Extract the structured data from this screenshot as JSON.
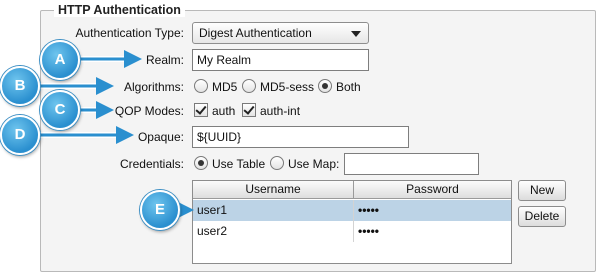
{
  "group": {
    "title": "HTTP Authentication"
  },
  "auth_type": {
    "label": "Authentication Type:",
    "value": "Digest Authentication"
  },
  "realm": {
    "label": "Realm:",
    "value": "My Realm"
  },
  "algorithms": {
    "label": "Algorithms:",
    "options": [
      {
        "label": "MD5",
        "selected": false
      },
      {
        "label": "MD5-sess",
        "selected": false
      },
      {
        "label": "Both",
        "selected": true
      }
    ]
  },
  "qop": {
    "label": "QOP Modes:",
    "options": [
      {
        "label": "auth",
        "checked": true
      },
      {
        "label": "auth-int",
        "checked": true
      }
    ]
  },
  "opaque": {
    "label": "Opaque:",
    "value": "${UUID}"
  },
  "credentials": {
    "label": "Credentials:",
    "use_table": {
      "label": "Use Table",
      "selected": true
    },
    "use_map": {
      "label": "Use Map:",
      "selected": false,
      "value": ""
    }
  },
  "table": {
    "headers": [
      "Username",
      "Password"
    ],
    "rows": [
      {
        "username": "user1",
        "password": "•••••",
        "selected": true
      },
      {
        "username": "user2",
        "password": "•••••",
        "selected": false
      }
    ]
  },
  "buttons": {
    "new": "New",
    "delete": "Delete"
  },
  "callouts": [
    "A",
    "B",
    "C",
    "D",
    "E"
  ],
  "colors": {
    "callout": "#2a8fcf",
    "selection": "#bcd3e6"
  }
}
